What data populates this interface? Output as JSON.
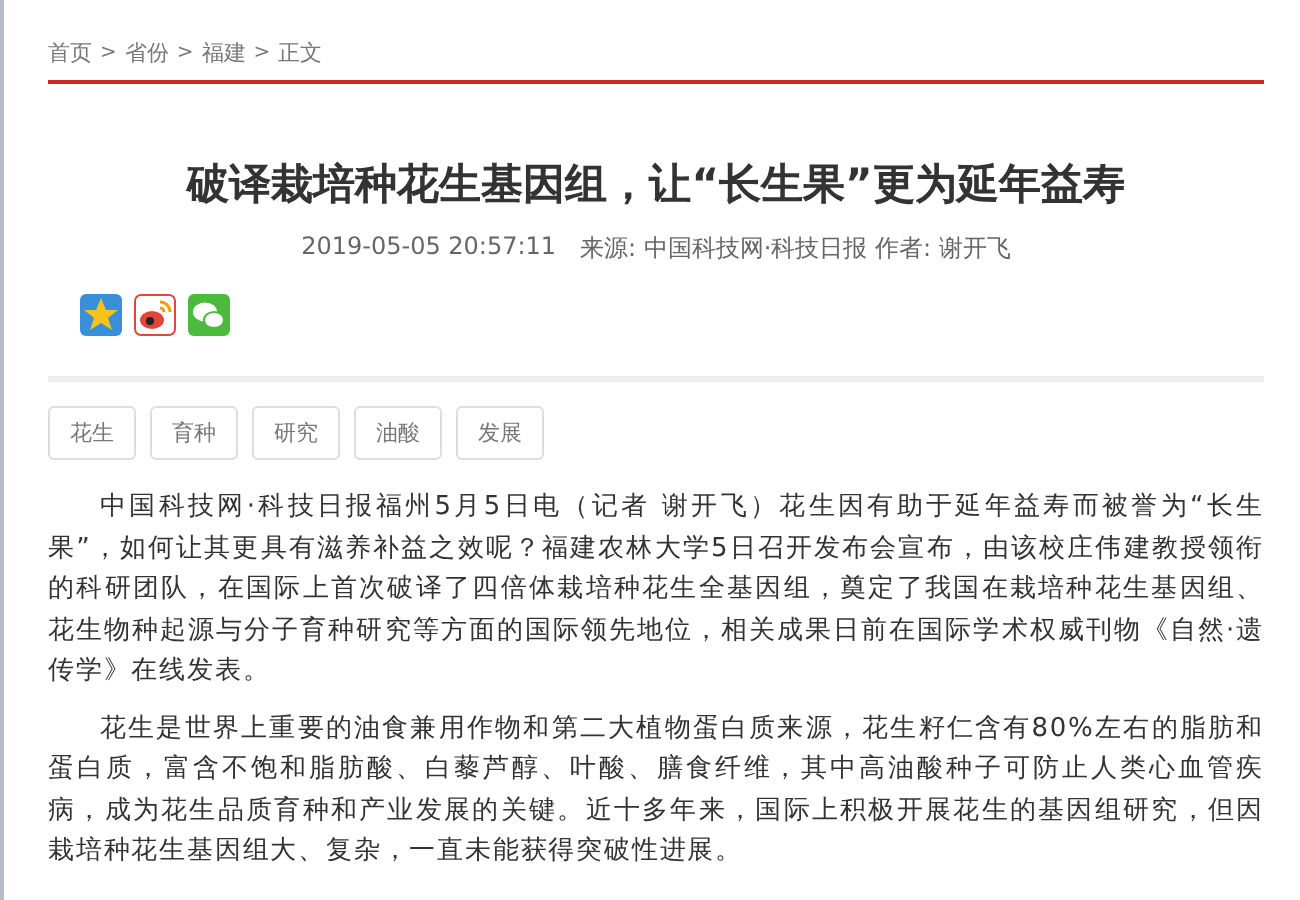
{
  "breadcrumb": [
    "首页",
    "省份",
    "福建",
    "正文"
  ],
  "breadcrumb_separator": ">",
  "title": "破译栽培种花生基因组，让“长生果”更为延年益寿",
  "meta": {
    "date": "2019-05-05 20:57:11",
    "source": "来源: 中国科技网·科技日报 作者: 谢开飞"
  },
  "share_icons": [
    {
      "kind": "qzone"
    },
    {
      "kind": "weibo"
    },
    {
      "kind": "wechat"
    }
  ],
  "tags": [
    "花生",
    "育种",
    "研究",
    "油酸",
    "发展"
  ],
  "paragraphs": [
    "中国科技网·科技日报福州5月5日电（记者 谢开飞）花生因有助于延年益寿而被誉为“长生果”，如何让其更具有滋养补益之效呢？福建农林大学5日召开发布会宣布，由该校庄伟建教授领衔的科研团队，在国际上首次破译了四倍体栽培种花生全基因组，奠定了我国在栽培种花生基因组、花生物种起源与分子育种研究等方面的国际领先地位，相关成果日前在国际学术权威刊物《自然·遗传学》在线发表。",
    "花生是世界上重要的油食兼用作物和第二大植物蛋白质来源，花生籽仁含有80%左右的脂肪和蛋白质，富含不饱和脂肪酸、白藜芦醇、叶酸、膳食纤维，其中高油酸种子可防止人类心血管疾病，成为花生品质育种和产业发展的关键。近十多年来，国际上积极开展花生的基因组研究，但因栽培种花生基因组大、复杂，一直未能获得突破性进展。"
  ]
}
